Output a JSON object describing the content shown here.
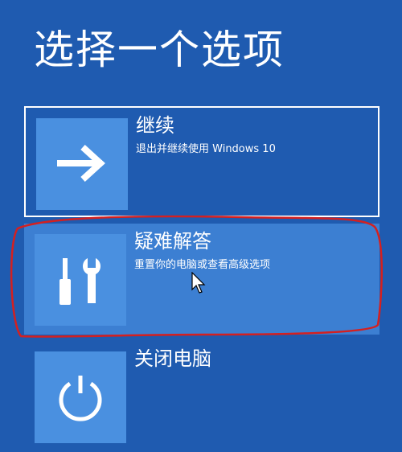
{
  "page": {
    "title": "选择一个选项",
    "background_color": "#1f5bb0"
  },
  "options": [
    {
      "title": "继续",
      "description": "退出并继续使用 Windows 10",
      "icon": "arrow-right-icon",
      "state": "outlined"
    },
    {
      "title": "疑难解答",
      "description": "重置你的电脑或查看高级选项",
      "icon": "tools-icon",
      "state": "highlighted"
    },
    {
      "title": "关闭电脑",
      "description": "",
      "icon": "power-icon",
      "state": "normal"
    }
  ],
  "annotation": {
    "color": "#d42020",
    "shape": "hand-drawn-ellipse"
  },
  "colors": {
    "tile_icon": "#4a90e0",
    "highlight": "#3c7fd2",
    "text": "#ffffff"
  }
}
